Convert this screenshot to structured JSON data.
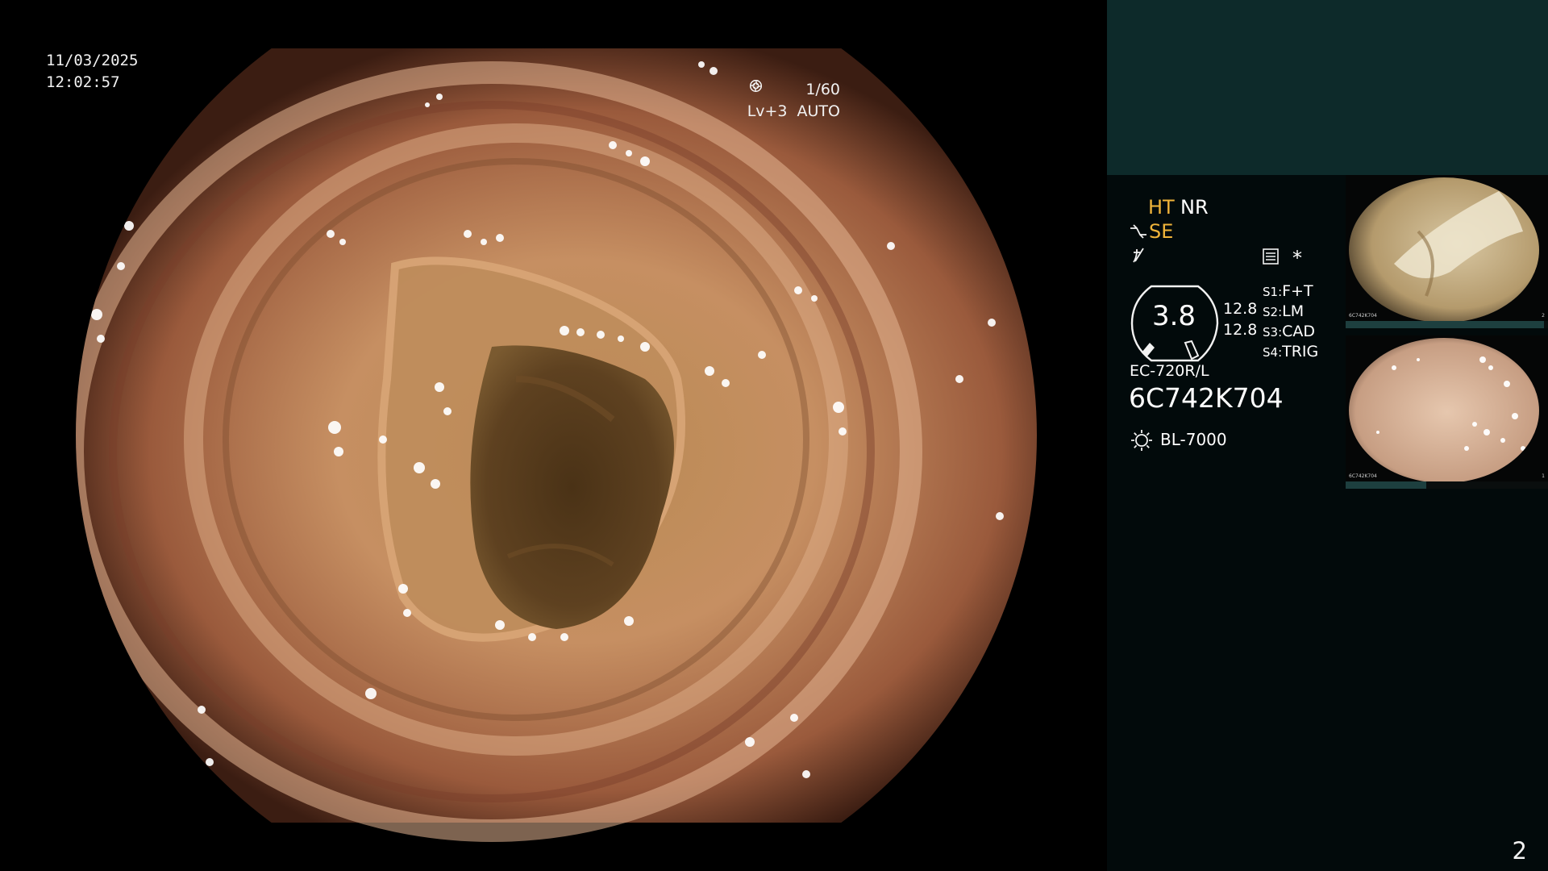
{
  "osd": {
    "date": "11/03/2025",
    "time": "12:02:57",
    "shutter": "1/60",
    "level": "Lv+3",
    "iris": "AUTO"
  },
  "panel": {
    "ht": "HT",
    "nr": "NR",
    "se": "SE",
    "gauge_value": "3.8",
    "value_a": "12.8",
    "value_b": "12.8",
    "star": "*",
    "slots": [
      {
        "key": "S1:",
        "value": "F+T"
      },
      {
        "key": "S2:",
        "value": "LM"
      },
      {
        "key": "S3:",
        "value": "CAD"
      },
      {
        "key": "S4:",
        "value": "TRIG"
      }
    ],
    "model": "EC-720R/L",
    "serial": "6C742K704",
    "light_source": "BL-7000",
    "icons": {
      "se": "scope-mode-icon",
      "fx": "function-icon",
      "menu": "menu-list-icon",
      "light": "light-source-icon",
      "shutter": "shutter-icon",
      "iris": "iris-icon"
    }
  },
  "thumbnails": [
    {
      "index": "2",
      "serial": "6C742K704",
      "progress": 0.98
    },
    {
      "index": "1",
      "serial": "6C742K704",
      "progress": 0.4
    }
  ],
  "page_number": "2",
  "colors": {
    "panel_top": "#0d2a2a",
    "panel_bg": "#020a0b",
    "accent": "#f0b43a",
    "text": "#f2f2f2"
  }
}
